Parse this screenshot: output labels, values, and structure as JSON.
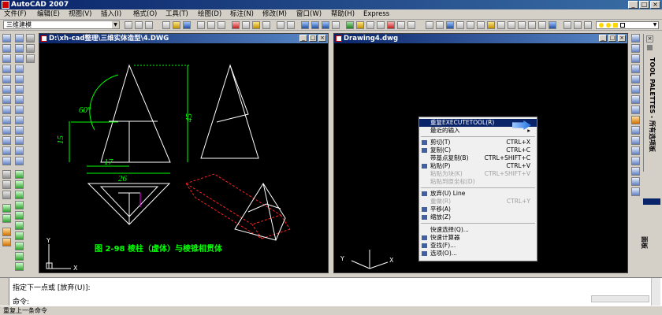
{
  "app": {
    "title": "AutoCAD 2007"
  },
  "window_buttons": {
    "minimize": "_",
    "maximize": "□",
    "close": "×"
  },
  "menu": [
    {
      "label": "文件(F)"
    },
    {
      "label": "编辑(E)"
    },
    {
      "label": "视图(V)"
    },
    {
      "label": "插入(I)"
    },
    {
      "label": "格式(O)"
    },
    {
      "label": "工具(T)"
    },
    {
      "label": "绘图(D)"
    },
    {
      "label": "标注(N)"
    },
    {
      "label": "修改(M)"
    },
    {
      "label": "窗口(W)"
    },
    {
      "label": "帮助(H)"
    },
    {
      "label": "Express"
    }
  ],
  "toolbar": {
    "workspace": "三维建模"
  },
  "drawing1": {
    "title": "D:\\xh-cad整理\\三维实体造型\\4.DWG",
    "dims": {
      "angle": "60°",
      "height": "45",
      "left": "15",
      "w17": "17",
      "w26": "26"
    },
    "caption": "图 2-98  棱柱（虚体）与棱锥相贯体",
    "axis_x": "X",
    "axis_y": "Y"
  },
  "drawing2": {
    "title": "Drawing4.dwg",
    "axis_x": "X",
    "axis_y": "Y"
  },
  "context_menu": {
    "repeat": "重复EXECUTETOOL(R)",
    "recent": "最近的输入",
    "cut": "剪切(T)",
    "cut_sc": "CTRL+X",
    "copy": "复制(C)",
    "copy_sc": "CTRL+C",
    "copybase": "带基点复制(B)",
    "copybase_sc": "CTRL+SHIFT+C",
    "paste": "粘贴(P)",
    "paste_sc": "CTRL+V",
    "pasteblock": "粘贴为块(K)",
    "pasteblock_sc": "CTRL+SHIFT+V",
    "pasteorig": "粘贴到原坐标(D)",
    "undo": "放弃(U) Line",
    "redo": "重做(R)",
    "redo_sc": "CTRL+Y",
    "pan": "平移(A)",
    "zoom": "缩放(Z)",
    "quickselect": "快速选择(Q)...",
    "quickcalc": "快速计算器",
    "find": "查找(F)...",
    "options": "选项(O)..."
  },
  "palette": {
    "label": "TOOL PALETTES - 所有选项板",
    "tab2": "面板"
  },
  "command": {
    "line1": "指定下一点或 [放弃(U)]:",
    "prompt": "命令:"
  },
  "status": {
    "text": "重复上一条命令"
  },
  "colors": {
    "accent": "#0a246a",
    "canvas": "#000000",
    "cad_green": "#00ff00",
    "cad_yellow": "#ffff00"
  }
}
